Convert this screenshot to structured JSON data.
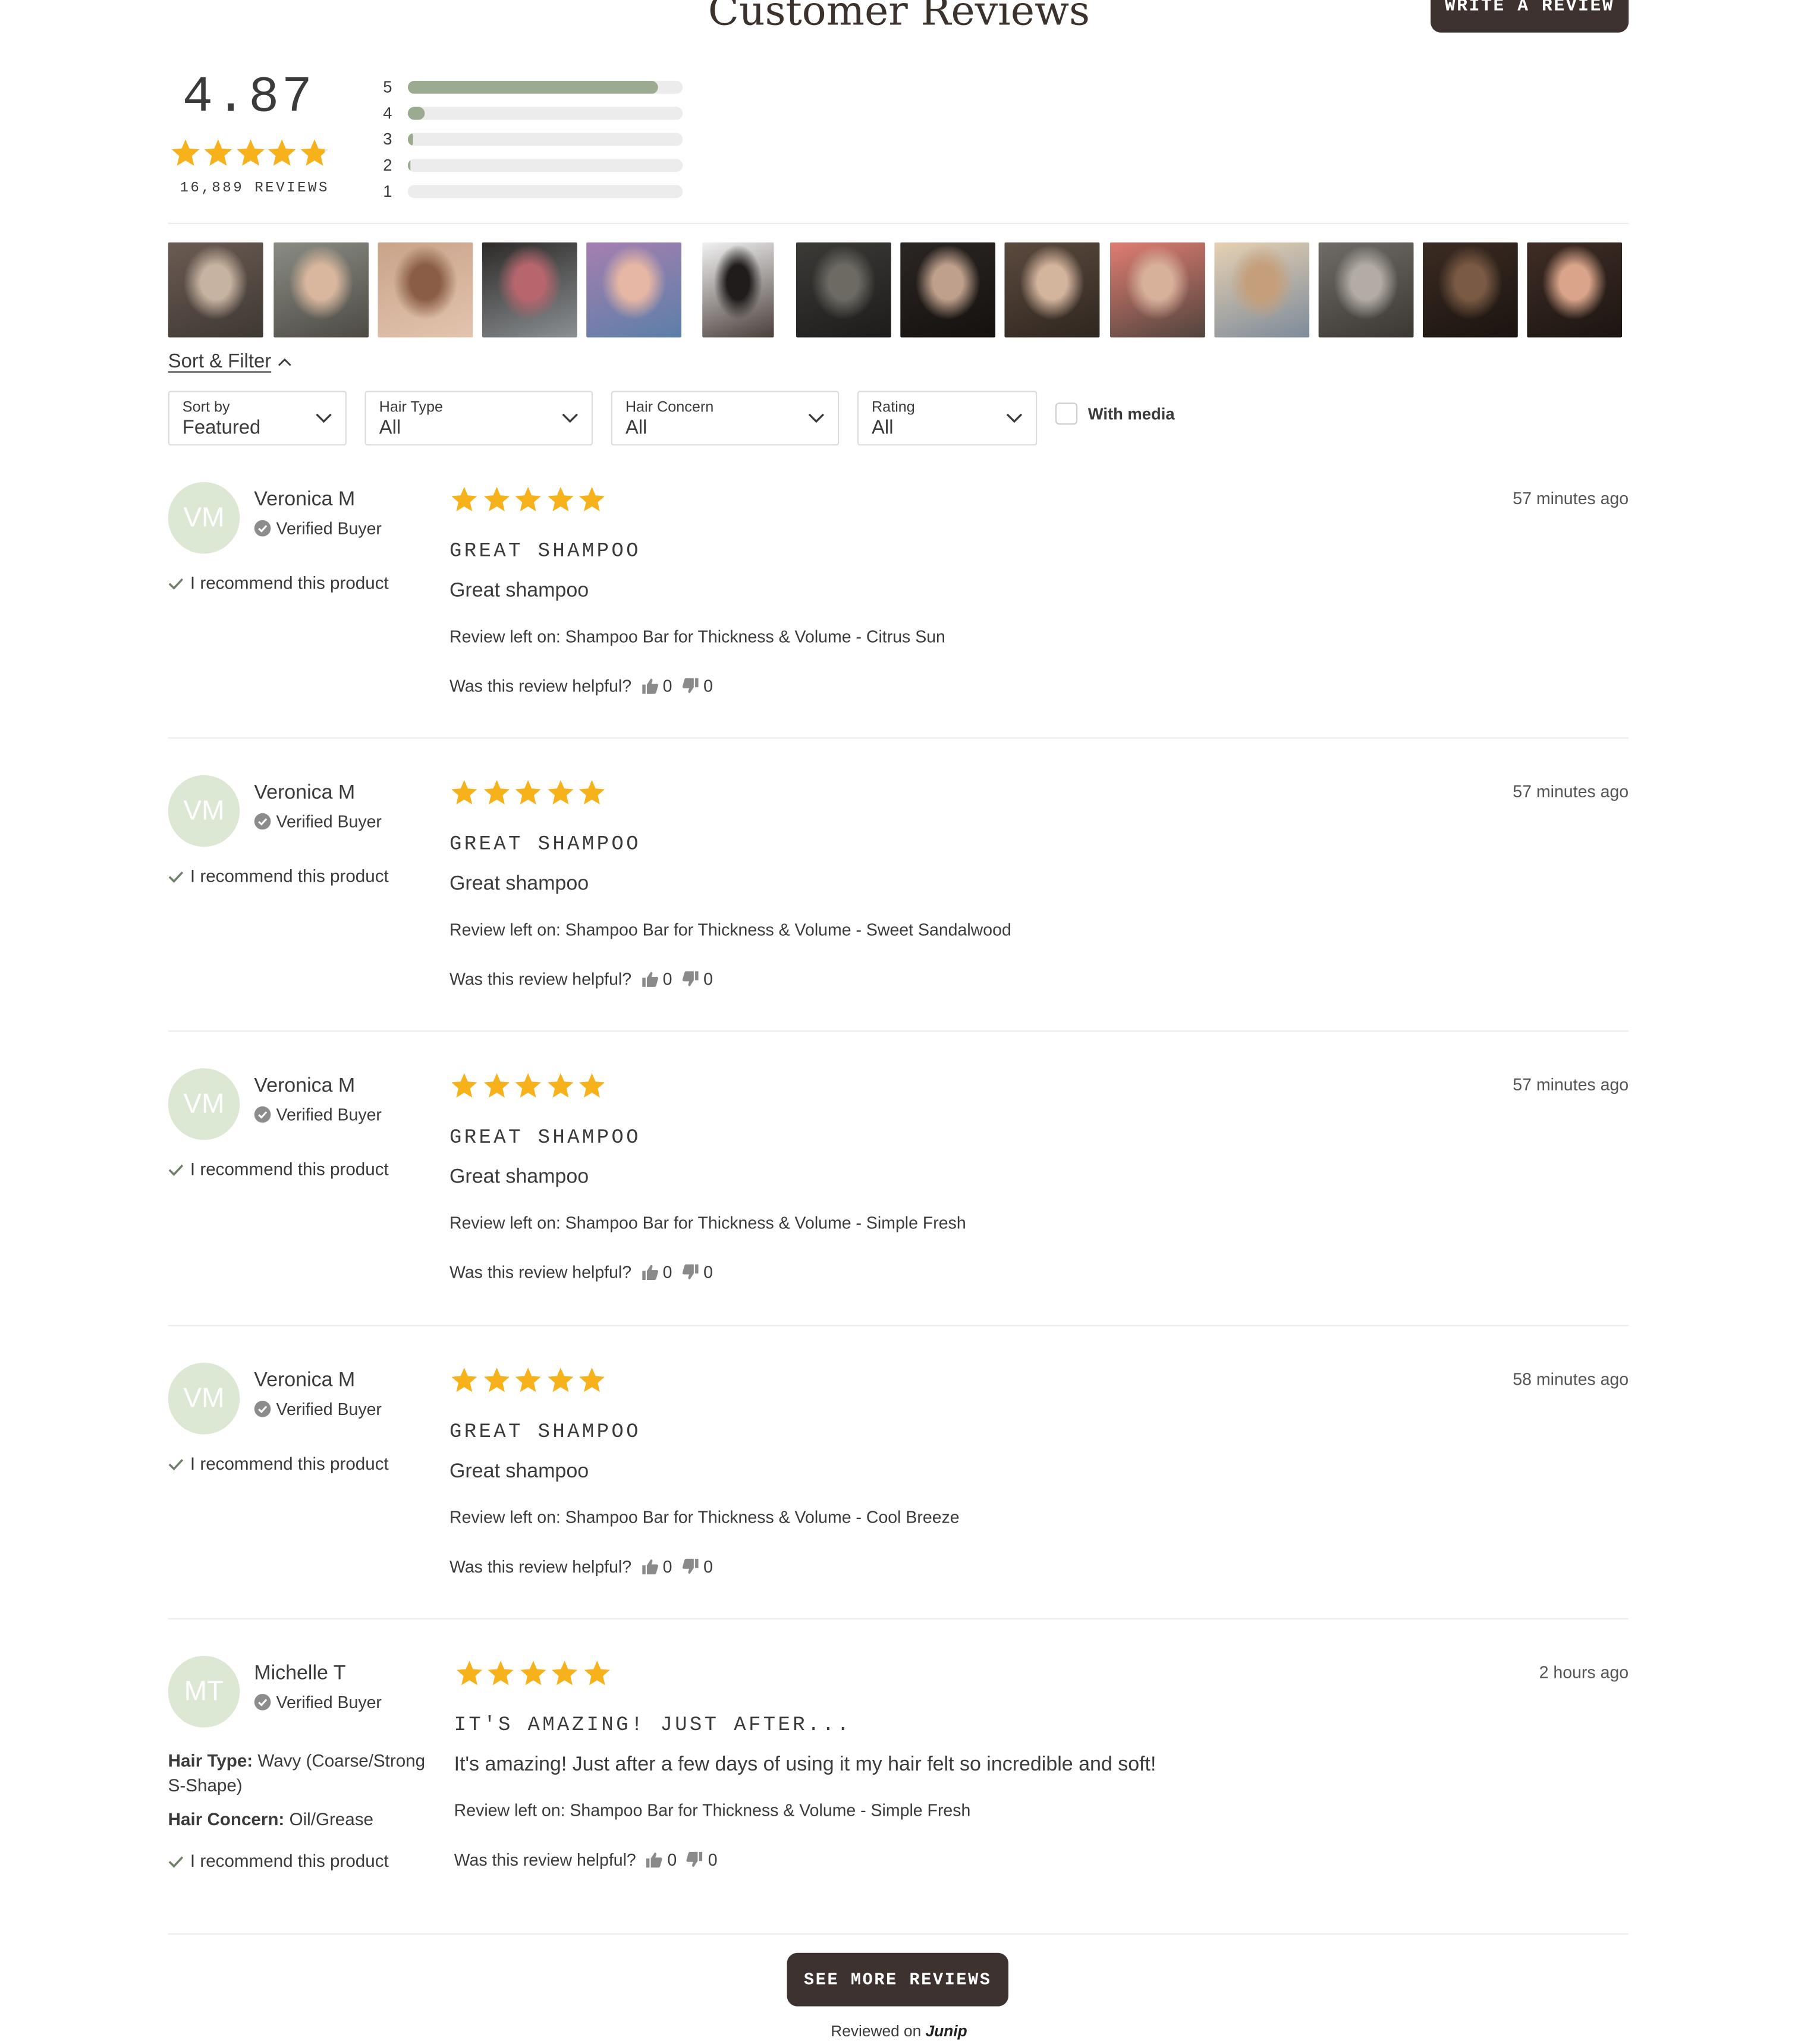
{
  "header": {
    "title": "Customer Reviews",
    "write_button": "WRITE A REVIEW"
  },
  "summary": {
    "average": "4.87",
    "star_rating": 4.87,
    "review_count": "16,889 REVIEWS",
    "histogram": [
      {
        "stars": "5",
        "fraction": 0.91
      },
      {
        "stars": "4",
        "fraction": 0.06
      },
      {
        "stars": "3",
        "fraction": 0.02
      },
      {
        "stars": "2",
        "fraction": 0.01
      },
      {
        "stars": "1",
        "fraction": 0.0
      }
    ]
  },
  "photos": [
    {
      "desc": "woman-with-man",
      "colors": [
        "#6b5b52",
        "#c7b3a1",
        "#3e3833"
      ]
    },
    {
      "desc": "woman-in-car",
      "colors": [
        "#8a8c84",
        "#d9b79e",
        "#4d4a44"
      ]
    },
    {
      "desc": "long-hair-back",
      "colors": [
        "#c9a38a",
        "#8a5e46",
        "#e3c4ae"
      ]
    },
    {
      "desc": "shampoo-bars-in-tin",
      "colors": [
        "#2d2a28",
        "#b8666e",
        "#8a8f92"
      ]
    },
    {
      "desc": "woman-scarf",
      "colors": [
        "#a57fb0",
        "#e6b7a4",
        "#5c7fa8"
      ]
    },
    {
      "desc": "dark-wavy-hair",
      "colors": [
        "#f2f2f2",
        "#1f1c1b",
        "#4a3f3b"
      ]
    },
    {
      "desc": "curly-dark-hair",
      "colors": [
        "#3c3a37",
        "#6c6a63",
        "#1e1c1b"
      ]
    },
    {
      "desc": "scalp-top-dark",
      "colors": [
        "#2b2623",
        "#bfa08c",
        "#15110f"
      ]
    },
    {
      "desc": "scalp-part",
      "colors": [
        "#5b4a3e",
        "#d3b49d",
        "#2f261f"
      ]
    },
    {
      "desc": "older-woman-pink",
      "colors": [
        "#e07d72",
        "#d8b19b",
        "#50443d"
      ]
    },
    {
      "desc": "blonde-woman",
      "colors": [
        "#e6d1b3",
        "#c59f7b",
        "#7d8b9a"
      ]
    },
    {
      "desc": "grey-hair-closeup",
      "colors": [
        "#6f6b66",
        "#b2aca4",
        "#3b3834"
      ]
    },
    {
      "desc": "beard-hand",
      "colors": [
        "#3b2b22",
        "#7a5a44",
        "#1b1410"
      ]
    },
    {
      "desc": "woman-smiling",
      "colors": [
        "#3f2d25",
        "#d9a48a",
        "#1c1512"
      ]
    }
  ],
  "filters": {
    "toggle_label": "Sort & Filter",
    "sort": {
      "label": "Sort by",
      "value": "Featured"
    },
    "hair_type": {
      "label": "Hair Type",
      "value": "All"
    },
    "hair_concern": {
      "label": "Hair Concern",
      "value": "All"
    },
    "rating": {
      "label": "Rating",
      "value": "All"
    },
    "with_media": "With media"
  },
  "reviews": [
    {
      "initials": "VM",
      "name": "Veronica M",
      "verified": "Verified Buyer",
      "recommend": "I recommend this product",
      "rating": 5,
      "date": "57 minutes ago",
      "title": "GREAT SHAMPOO",
      "body": "Great shampoo",
      "product": "Review left on: Shampoo Bar for Thickness & Volume - Citrus Sun",
      "helpful_label": "Was this review helpful?",
      "up": "0",
      "down": "0"
    },
    {
      "initials": "VM",
      "name": "Veronica M",
      "verified": "Verified Buyer",
      "recommend": "I recommend this product",
      "rating": 5,
      "date": "57 minutes ago",
      "title": "GREAT SHAMPOO",
      "body": "Great shampoo",
      "product": "Review left on: Shampoo Bar for Thickness & Volume - Sweet Sandalwood",
      "helpful_label": "Was this review helpful?",
      "up": "0",
      "down": "0"
    },
    {
      "initials": "VM",
      "name": "Veronica M",
      "verified": "Verified Buyer",
      "recommend": "I recommend this product",
      "rating": 5,
      "date": "57 minutes ago",
      "title": "GREAT SHAMPOO",
      "body": "Great shampoo",
      "product": "Review left on: Shampoo Bar for Thickness & Volume - Simple Fresh",
      "helpful_label": "Was this review helpful?",
      "up": "0",
      "down": "0"
    },
    {
      "initials": "VM",
      "name": "Veronica M",
      "verified": "Verified Buyer",
      "recommend": "I recommend this product",
      "rating": 5,
      "date": "58 minutes ago",
      "title": "GREAT SHAMPOO",
      "body": "Great shampoo",
      "product": "Review left on: Shampoo Bar for Thickness & Volume - Cool Breeze",
      "helpful_label": "Was this review helpful?",
      "up": "0",
      "down": "0"
    },
    {
      "initials": "MT",
      "name": "Michelle T",
      "verified": "Verified Buyer",
      "hair_type_label": "Hair Type:",
      "hair_type": "Wavy (Coarse/Strong S-Shape)",
      "hair_concern_label": "Hair Concern:",
      "hair_concern": "Oil/Grease",
      "recommend": "I recommend this product",
      "rating": 5,
      "date": "2 hours ago",
      "title": "IT'S AMAZING! JUST AFTER...",
      "body": "It's amazing! Just after a few days of using it my hair felt so incredible and soft!",
      "product": "Review left on: Shampoo Bar for Thickness & Volume - Simple Fresh",
      "helpful_label": "Was this review helpful?",
      "up": "0",
      "down": "0"
    }
  ],
  "footer": {
    "see_more": "SEE MORE REVIEWS",
    "powered_prefix": "Reviewed on",
    "powered_brand": "Junip"
  },
  "colors": {
    "star": "#f7b11b",
    "bar_fill": "#9aab8f",
    "button_bg": "#3d3230",
    "avatar_bg": "#dce8d3"
  }
}
